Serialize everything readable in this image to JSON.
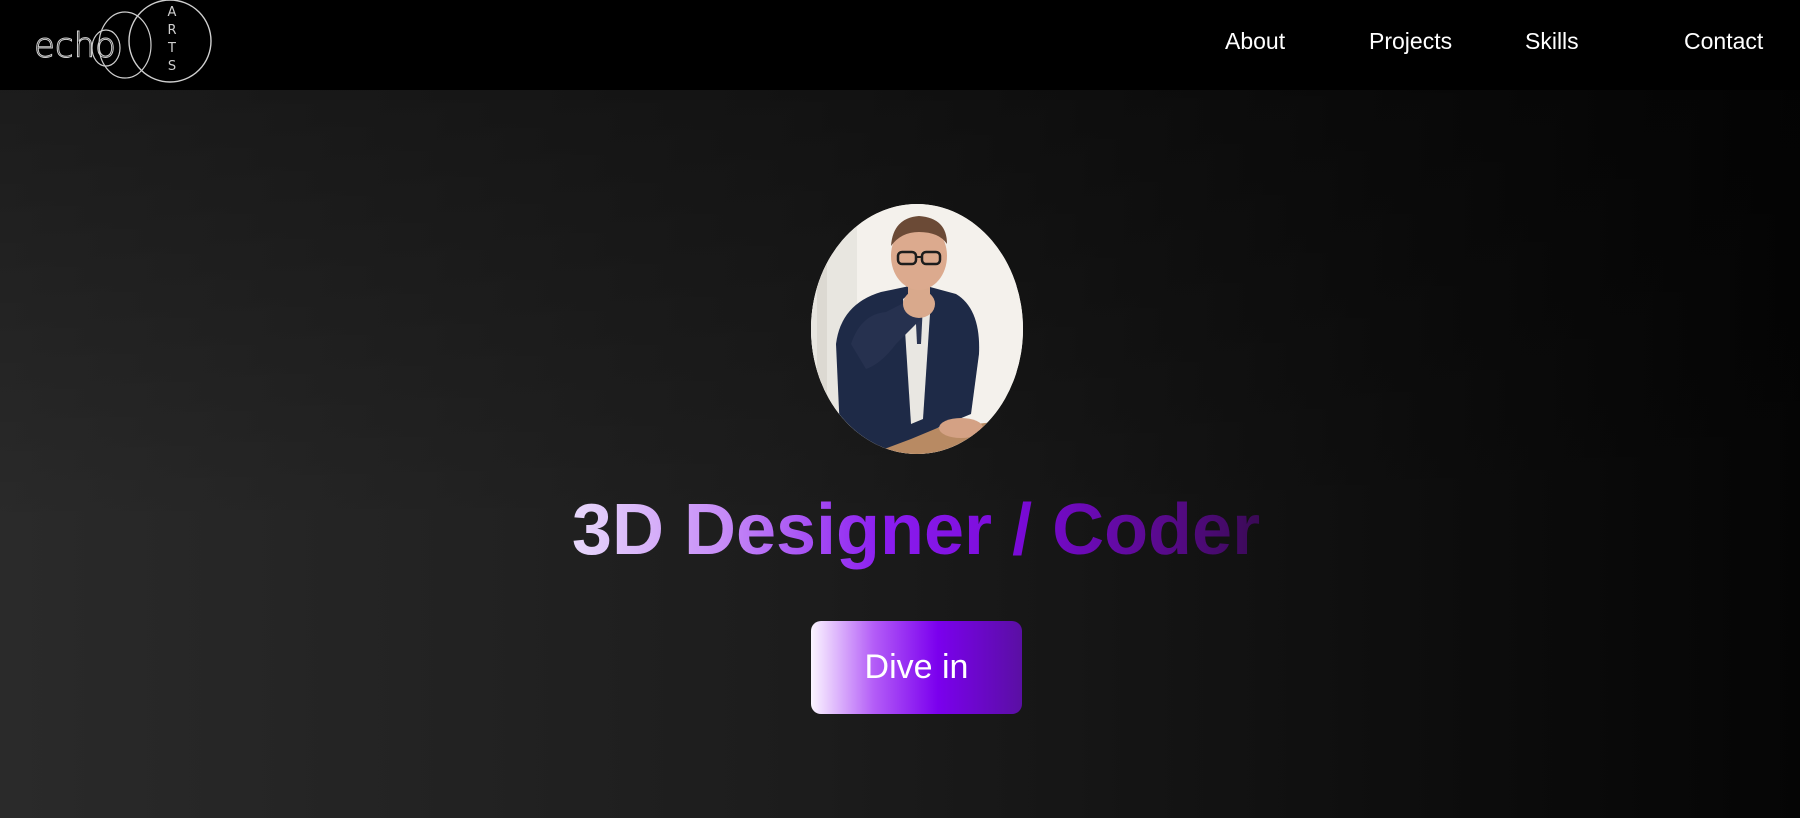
{
  "logo": {
    "text": "echo",
    "side_letters": [
      "A",
      "R",
      "T",
      "S"
    ]
  },
  "nav": {
    "items": [
      {
        "label": "About"
      },
      {
        "label": "Projects"
      },
      {
        "label": "Skills"
      },
      {
        "label": "Contact"
      }
    ]
  },
  "hero": {
    "avatar_icon": "profile-photo",
    "headline": "3D Designer / Coder",
    "cta_label": "Dive in"
  },
  "colors": {
    "header_bg": "#000000",
    "accent_purple": "#7b00ee",
    "headline_start": "#e8d9fb",
    "headline_end": "#3a0a55"
  }
}
